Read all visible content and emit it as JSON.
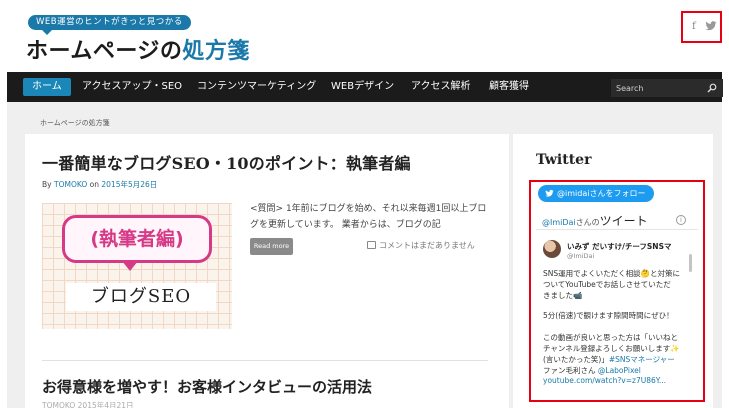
{
  "header": {
    "tagline": "WEB運営のヒントがきっと見つかる",
    "site_title_main": "ホームページの",
    "site_title_accent": "処方箋",
    "social": {
      "facebook_glyph": "f",
      "icons": [
        "facebook-icon",
        "twitter-icon"
      ]
    }
  },
  "nav": {
    "items": [
      "ホーム",
      "アクセスアップ・SEO",
      "コンテンツマーケティング",
      "WEBデザイン",
      "アクセス解析",
      "顧客獲得"
    ],
    "active_index": 0,
    "search_placeholder": "Search"
  },
  "breadcrumb": "ホームページの処方箋",
  "posts": [
    {
      "title": "一番簡単なブログSEO・10のポイント：執筆者編",
      "meta_prefix": "By",
      "author": "TOMOKO",
      "meta_on": "on",
      "date": "2015年5月26日",
      "thumbnail_bubble": "(執筆者編)",
      "thumbnail_caption": "ブログSEO",
      "excerpt": "<質問> 1年前にブログを始め、それ以来毎週1回以上ブログを更新しています。 業者からは、ブログの記",
      "read_more": "Read more",
      "comments": "コメントはまだありません"
    },
    {
      "title": "お得意様を増やす！お客様インタビューの活用法",
      "meta": "TOMOKO    2015年4月21日"
    }
  ],
  "sidebar": {
    "widget_title": "Twitter",
    "follow_button": "@imidaiさんをフォロー",
    "tweets_header_handle": "@ImiDai",
    "tweets_header_suffix": "さんの",
    "tweets_header_big": "ツイート",
    "info_glyph": "i",
    "tweet": {
      "name": "いみず だいすけ/チーフSNSマ",
      "handle": "@ImiDai",
      "lines": [
        "SNS運用でよくいただく相談🤔と対策に",
        "ついてYouTubeでお話しさせていただ",
        "きました📹",
        "",
        "5分(倍速)で観けます隙間時間にぜひ！",
        "",
        "この動画が良いと思った方は「いいねと",
        "チャンネル登録よろしくお願いします✨",
        "(言いたかった笑)」#SNSマネージャー",
        "ファン毛利さん @LaboPixel",
        "youtube.com/watch?v=z7U86Y..."
      ]
    }
  },
  "colors": {
    "accent": "#1a79a9",
    "nav_bg": "#1b1b1b",
    "nav_active": "#1a87b8",
    "highlight_border": "#e60012",
    "twitter_blue": "#1d9bf0",
    "thumb_pink": "#d63a86"
  }
}
